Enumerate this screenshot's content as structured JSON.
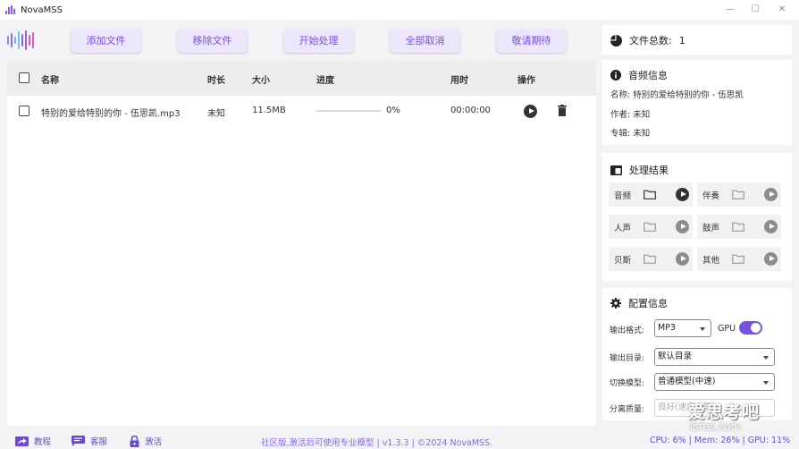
{
  "window": {
    "title": "NovaMSS",
    "minimize": "—",
    "maximize": "☐",
    "close": "✕"
  },
  "toolbar": {
    "buttons": [
      {
        "label": "添加文件"
      },
      {
        "label": "移除文件"
      },
      {
        "label": "开始处理"
      },
      {
        "label": "全部取消"
      },
      {
        "label": "敬请期待"
      }
    ]
  },
  "table": {
    "headers": {
      "name": "名称",
      "duration": "时长",
      "size": "大小",
      "progress": "进度",
      "time_used": "用时",
      "actions": "操作"
    },
    "rows": [
      {
        "name": "特别的爱给特别的你 - 伍思凯.mp3",
        "duration": "未知",
        "size": "11.5MB",
        "progress_text": "0%",
        "progress_value": 0,
        "time_used": "00:00:00"
      }
    ]
  },
  "file_count": {
    "label": "文件总数:",
    "value": "1"
  },
  "audio_info": {
    "title": "音频信息",
    "name_label": "名称:",
    "name_value": "特别的爱给特别的你 - 伍思凯",
    "artist_label": "作者:",
    "artist_value": "未知",
    "album_label": "专辑:",
    "album_value": "未知"
  },
  "results": {
    "title": "处理结果",
    "items": [
      {
        "label": "音频",
        "active": true
      },
      {
        "label": "伴奏",
        "active": false
      },
      {
        "label": "人声",
        "active": false
      },
      {
        "label": "鼓声",
        "active": false
      },
      {
        "label": "贝斯",
        "active": false
      },
      {
        "label": "其他",
        "active": false
      }
    ]
  },
  "config": {
    "title": "配置信息",
    "format_label": "输出格式:",
    "format_value": "MP3",
    "gpu_label": "GPU",
    "gpu_enabled": true,
    "dir_label": "输出目录:",
    "dir_value": "默认目录",
    "model_label": "切换模型:",
    "model_value": "普通模型(中速)",
    "quality_label": "分离质量:",
    "quality_value": "良好(速度中等)"
  },
  "status": {
    "tutorial": "教程",
    "support": "客服",
    "activate": "激活",
    "center": "社区版,激活后可使用专业模型 | v1.3.3 | ©2024 NovaMSS.",
    "right": "CPU: 6% | Mem: 26% | GPU: 11%"
  },
  "watermark": {
    "line1": "爱思考吧",
    "line2": "isres.com"
  },
  "colors": {
    "accent": "#7b4fe6",
    "button_bg": "#ece6fb"
  }
}
